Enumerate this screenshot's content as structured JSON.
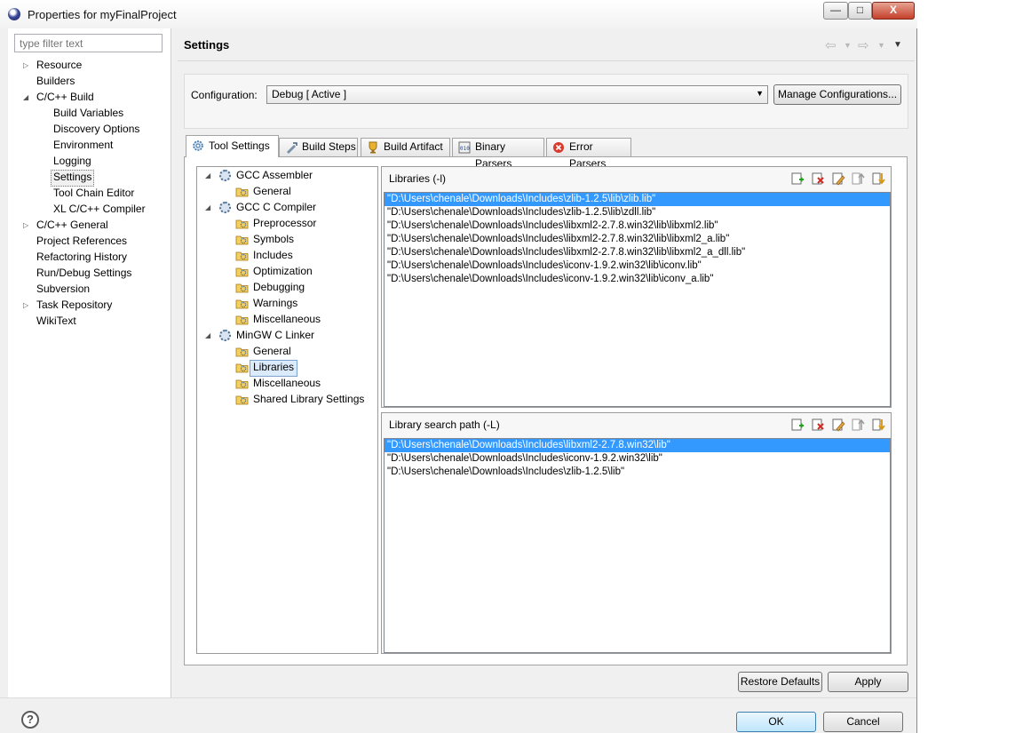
{
  "window": {
    "title": "Properties for myFinalProject",
    "controls": {
      "minimize": "—",
      "maximize": "□",
      "close": "X"
    }
  },
  "sidebar": {
    "filter_placeholder": "type filter text",
    "items": [
      {
        "label": "Resource",
        "level": 0,
        "expander": "collapsed"
      },
      {
        "label": "Builders",
        "level": 0
      },
      {
        "label": "C/C++ Build",
        "level": 0,
        "expander": "expanded"
      },
      {
        "label": "Build Variables",
        "level": 1
      },
      {
        "label": "Discovery Options",
        "level": 1
      },
      {
        "label": "Environment",
        "level": 1
      },
      {
        "label": "Logging",
        "level": 1
      },
      {
        "label": "Settings",
        "level": 1,
        "selected": true
      },
      {
        "label": "Tool Chain Editor",
        "level": 1
      },
      {
        "label": "XL C/C++ Compiler",
        "level": 1
      },
      {
        "label": "C/C++ General",
        "level": 0,
        "expander": "collapsed"
      },
      {
        "label": "Project References",
        "level": 0
      },
      {
        "label": "Refactoring History",
        "level": 0
      },
      {
        "label": "Run/Debug Settings",
        "level": 0
      },
      {
        "label": "Subversion",
        "level": 0
      },
      {
        "label": "Task Repository",
        "level": 0,
        "expander": "collapsed"
      },
      {
        "label": "WikiText",
        "level": 0
      }
    ]
  },
  "header": {
    "title": "Settings"
  },
  "configuration": {
    "label": "Configuration:",
    "value": "Debug  [ Active ]",
    "manage_button": "Manage Configurations..."
  },
  "tabs": [
    {
      "label": "Tool Settings",
      "active": true,
      "icon": "tool-settings-icon"
    },
    {
      "label": "Build Steps",
      "icon": "build-steps-icon"
    },
    {
      "label": "Build Artifact",
      "icon": "build-artifact-icon"
    },
    {
      "label": "Binary Parsers",
      "icon": "binary-parsers-icon"
    },
    {
      "label": "Error Parsers",
      "icon": "error-parsers-icon"
    }
  ],
  "tool_tree": [
    {
      "label": "GCC Assembler",
      "type": "tool"
    },
    {
      "label": "General",
      "type": "option"
    },
    {
      "label": "GCC C Compiler",
      "type": "tool"
    },
    {
      "label": "Preprocessor",
      "type": "option"
    },
    {
      "label": "Symbols",
      "type": "option"
    },
    {
      "label": "Includes",
      "type": "option"
    },
    {
      "label": "Optimization",
      "type": "option"
    },
    {
      "label": "Debugging",
      "type": "option"
    },
    {
      "label": "Warnings",
      "type": "option"
    },
    {
      "label": "Miscellaneous",
      "type": "option"
    },
    {
      "label": "MinGW C Linker",
      "type": "tool"
    },
    {
      "label": "General",
      "type": "option"
    },
    {
      "label": "Libraries",
      "type": "option",
      "selected": true
    },
    {
      "label": "Miscellaneous",
      "type": "option"
    },
    {
      "label": "Shared Library Settings",
      "type": "option"
    }
  ],
  "libraries": {
    "title": "Libraries (-l)",
    "items": [
      "\"D:\\Users\\chenale\\Downloads\\Includes\\zlib-1.2.5\\lib\\zlib.lib\"",
      "\"D:\\Users\\chenale\\Downloads\\Includes\\zlib-1.2.5\\lib\\zdll.lib\"",
      "\"D:\\Users\\chenale\\Downloads\\Includes\\libxml2-2.7.8.win32\\lib\\libxml2.lib\"",
      "\"D:\\Users\\chenale\\Downloads\\Includes\\libxml2-2.7.8.win32\\lib\\libxml2_a.lib\"",
      "\"D:\\Users\\chenale\\Downloads\\Includes\\libxml2-2.7.8.win32\\lib\\libxml2_a_dll.lib\"",
      "\"D:\\Users\\chenale\\Downloads\\Includes\\iconv-1.9.2.win32\\lib\\iconv.lib\"",
      "\"D:\\Users\\chenale\\Downloads\\Includes\\iconv-1.9.2.win32\\lib\\iconv_a.lib\""
    ],
    "selected_index": 0
  },
  "library_paths": {
    "title": "Library search path (-L)",
    "items": [
      "\"D:\\Users\\chenale\\Downloads\\Includes\\libxml2-2.7.8.win32\\lib\"",
      "\"D:\\Users\\chenale\\Downloads\\Includes\\iconv-1.9.2.win32\\lib\"",
      "\"D:\\Users\\chenale\\Downloads\\Includes\\zlib-1.2.5\\lib\""
    ],
    "selected_index": 0
  },
  "list_toolbar_icons": [
    "add-icon",
    "delete-icon",
    "edit-icon",
    "move-up-icon",
    "move-down-icon"
  ],
  "buttons": {
    "restore_defaults": "Restore Defaults",
    "apply": "Apply",
    "ok": "OK",
    "cancel": "Cancel",
    "help": "?"
  },
  "colors": {
    "selection": "#3399ff",
    "window_bg": "#f0f0f0",
    "close_button": "#c4402a"
  }
}
